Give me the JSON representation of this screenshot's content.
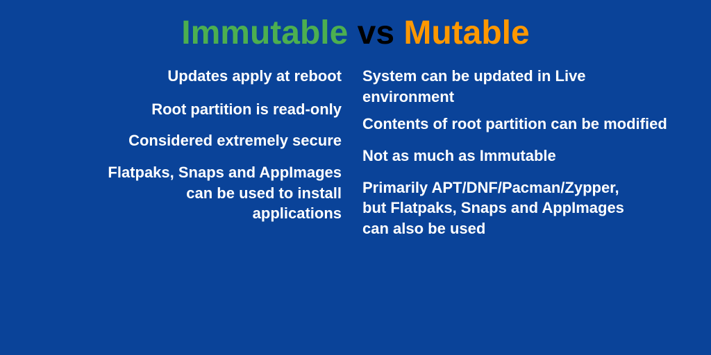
{
  "title": {
    "immutable": "Immutable",
    "vs": " vs ",
    "mutable": "Mutable"
  },
  "left": {
    "row1": "Updates apply at reboot",
    "row2": "Root partition is read-only",
    "row3": "Considered extremely secure",
    "row4": "Flatpaks, Snaps and AppImages can be used to install applications"
  },
  "right": {
    "row1": "System can be updated in Live environment",
    "row2": "Contents of root partition can be modified",
    "row3": "Not as much as Immutable",
    "row4": "Primarily APT/DNF/Pacman/Zypper, but Flatpaks, Snaps and AppImages can also be used"
  }
}
